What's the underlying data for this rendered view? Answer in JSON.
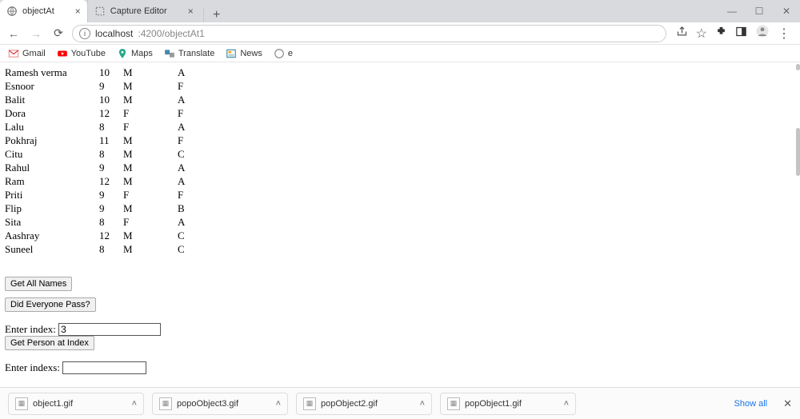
{
  "tabs": [
    {
      "title": "objectAt",
      "active": true
    },
    {
      "title": "Capture Editor",
      "active": false
    }
  ],
  "url": {
    "host": "localhost",
    "port_path": ":4200/objectAt1"
  },
  "bookmarks": [
    {
      "label": "Gmail"
    },
    {
      "label": "YouTube"
    },
    {
      "label": "Maps"
    },
    {
      "label": "Translate"
    },
    {
      "label": "News"
    },
    {
      "label": "e"
    }
  ],
  "table_rows": [
    {
      "name": "Ramesh verma",
      "v1": "10",
      "v2": "M",
      "v3": "A"
    },
    {
      "name": "Esnoor",
      "v1": "9",
      "v2": "M",
      "v3": "F"
    },
    {
      "name": "Balit",
      "v1": "10",
      "v2": "M",
      "v3": "A"
    },
    {
      "name": "Dora",
      "v1": "12",
      "v2": "F",
      "v3": "F"
    },
    {
      "name": "Lalu",
      "v1": "8",
      "v2": "F",
      "v3": "A"
    },
    {
      "name": "Pokhraj",
      "v1": "11",
      "v2": "M",
      "v3": "F"
    },
    {
      "name": "Citu",
      "v1": "8",
      "v2": "M",
      "v3": "C"
    },
    {
      "name": "Rahul",
      "v1": "9",
      "v2": "M",
      "v3": "A"
    },
    {
      "name": "Ram",
      "v1": "12",
      "v2": "M",
      "v3": "A"
    },
    {
      "name": "Priti",
      "v1": "9",
      "v2": "F",
      "v3": "F"
    },
    {
      "name": "Flip",
      "v1": "9",
      "v2": "M",
      "v3": "B"
    },
    {
      "name": "Sita",
      "v1": "8",
      "v2": "F",
      "v3": "A"
    },
    {
      "name": "Aashray",
      "v1": "12",
      "v2": "M",
      "v3": "C"
    },
    {
      "name": "Suneel",
      "v1": "8",
      "v2": "M",
      "v3": "C"
    }
  ],
  "buttons": {
    "get_all_names": "Get All Names",
    "did_everyone_pass": "Did Everyone Pass?",
    "get_person_at_index": "Get Person at Index"
  },
  "labels": {
    "enter_index": "Enter index:",
    "enter_indexs": "Enter indexs:"
  },
  "inputs": {
    "index_value": "3",
    "indexs_value": ""
  },
  "downloads": [
    {
      "file": "object1.gif"
    },
    {
      "file": "popoObject3.gif"
    },
    {
      "file": "popObject2.gif"
    },
    {
      "file": "popObject1.gif"
    }
  ],
  "download_shelf": {
    "show_all": "Show all"
  }
}
